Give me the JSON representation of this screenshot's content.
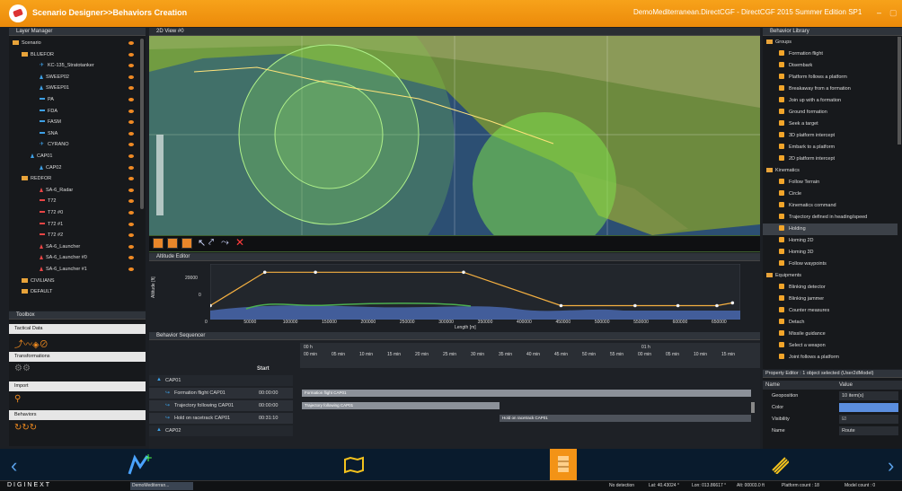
{
  "app": {
    "title": "Scenario Designer>>Behaviors Creation",
    "context": "DemoMediterranean.DirectCGF - DirectCGF 2015 Summer Edition SP1"
  },
  "layer_manager": {
    "title": "Layer Manager",
    "items": [
      {
        "label": "Scenario",
        "indent": 0,
        "icon": "folder"
      },
      {
        "label": "BLUEFOR",
        "indent": 1,
        "icon": "folder"
      },
      {
        "label": "KC-135_Stratotanker",
        "indent": 3,
        "icon": "plane"
      },
      {
        "label": "SWEEP02",
        "indent": 3,
        "icon": "up"
      },
      {
        "label": "SWEEP01",
        "indent": 3,
        "icon": "up"
      },
      {
        "label": "PA",
        "indent": 3,
        "icon": "dash"
      },
      {
        "label": "FDA",
        "indent": 3,
        "icon": "dash"
      },
      {
        "label": "FASM",
        "indent": 3,
        "icon": "dash"
      },
      {
        "label": "SNA",
        "indent": 3,
        "icon": "dash"
      },
      {
        "label": "CYRANO",
        "indent": 3,
        "icon": "plane"
      },
      {
        "label": "CAP01",
        "indent": 2,
        "icon": "up"
      },
      {
        "label": "CAP02",
        "indent": 3,
        "icon": "up"
      },
      {
        "label": "REDFOR",
        "indent": 1,
        "icon": "folder"
      },
      {
        "label": "SA-6_Radar",
        "indent": 3,
        "icon": "up-red"
      },
      {
        "label": "T72",
        "indent": 3,
        "icon": "dash-red"
      },
      {
        "label": "T72 #0",
        "indent": 3,
        "icon": "dash-red"
      },
      {
        "label": "T72 #1",
        "indent": 3,
        "icon": "dash-red"
      },
      {
        "label": "T72 #2",
        "indent": 3,
        "icon": "dash-red"
      },
      {
        "label": "SA-6_Launcher",
        "indent": 3,
        "icon": "up-red"
      },
      {
        "label": "SA-6_Launcher #0",
        "indent": 3,
        "icon": "up-red"
      },
      {
        "label": "SA-6_Launcher #1",
        "indent": 3,
        "icon": "up-red"
      },
      {
        "label": "CIVILIANS",
        "indent": 1,
        "icon": "folder"
      },
      {
        "label": "DEFAULT",
        "indent": 1,
        "icon": "folder"
      }
    ]
  },
  "toolbox": {
    "title": "Toolbox",
    "sections": [
      "Tactical Data",
      "Transformations",
      "Import",
      "Behaviors"
    ]
  },
  "view2d": {
    "title": "2D View #0"
  },
  "altitude": {
    "title": "Altitude Editor",
    "ylabel": "Altitude [ft]",
    "xlabel": "Length [m]",
    "yticks": [
      "20000",
      "0"
    ],
    "xticks": [
      "0",
      "50000",
      "100000",
      "150000",
      "200000",
      "250000",
      "300000",
      "350000",
      "400000",
      "450000",
      "500000",
      "550000",
      "600000",
      "650000"
    ]
  },
  "chart_data": {
    "type": "line",
    "title": "",
    "xlabel": "Length [m]",
    "ylabel": "Altitude [ft]",
    "xlim": [
      0,
      680000
    ],
    "ylim": [
      -8000,
      32000
    ],
    "series": [
      {
        "values": [
          [
            0,
            2000
          ],
          [
            70000,
            26000
          ],
          [
            135000,
            26000
          ],
          [
            325000,
            26000
          ],
          [
            450000,
            2000
          ],
          [
            545000,
            2000
          ],
          [
            600000,
            2000
          ],
          [
            650000,
            2000
          ],
          [
            670000,
            4000
          ]
        ]
      }
    ]
  },
  "sequencer": {
    "title": "Behavior Sequencer",
    "start_label": "Start",
    "time_head": [
      "00 h",
      "01 h"
    ],
    "time_ticks": [
      "00 min",
      "05 min",
      "10 min",
      "15 min",
      "20 min",
      "25 min",
      "30 min",
      "35 min",
      "40 min",
      "45 min",
      "50 min",
      "55 min",
      "00 min",
      "05 min",
      "10 min",
      "15 min"
    ],
    "rows": [
      {
        "label": "CAP01",
        "start": "",
        "bar": "",
        "level": 0
      },
      {
        "label": "Formation flight CAP01",
        "start": "00:00:00",
        "bar": "Formation flight CAP01",
        "level": 1
      },
      {
        "label": "Trajectory following CAP01",
        "start": "00:00:00",
        "bar": "Trajectory following CAP01",
        "level": 1
      },
      {
        "label": "Hold on racetrack CAP01",
        "start": "00:31:10",
        "bar": "Hold on racetrack CAP01",
        "level": 1
      },
      {
        "label": "CAP02",
        "start": "",
        "bar": "",
        "level": 0
      }
    ]
  },
  "behavior_library": {
    "title": "Behavior Library",
    "groups": [
      {
        "label": "Groups",
        "items": [
          "Formation flight",
          "Disembark",
          "Platform follows a platform",
          "Breakaway from a formation",
          "Join up with a formation",
          "Ground formation",
          "Seek a target",
          "3D platform intercept",
          "Embark to a platform",
          "2D platform intercept"
        ]
      },
      {
        "label": "Kinematics",
        "items": [
          "Follow Terrain",
          "Circle",
          "Kinematics command",
          "Trajectory defined in heading/speed",
          "Holding",
          "Homing 2D",
          "Homing 3D",
          "Follow waypoints"
        ]
      },
      {
        "label": "Equipments",
        "items": [
          "Blinking detector",
          "Blinking jammer",
          "Counter measures",
          "Detach",
          "Missile guidance",
          "Select a weapon",
          "Joint follows a platform"
        ]
      }
    ],
    "selected": "Holding"
  },
  "property_editor": {
    "title": "Property Editor : 1 object selected (User2dModel)",
    "col_name": "Name",
    "col_value": "Value",
    "rows": [
      {
        "name": "Geoposition",
        "value": "10 item(s)"
      },
      {
        "name": "Color",
        "value": ""
      },
      {
        "name": "Visibility",
        "value": "☑"
      },
      {
        "name": "Name",
        "value": "Route"
      }
    ]
  },
  "status": {
    "brand": "DIGINEXT",
    "detection": "No detection",
    "lat": "Lat: 40.43024 °",
    "lon": "Lon: 013.86617 °",
    "alt": "Alt: 00003.0 ft",
    "platforms": "Platform count : 18",
    "models": "Model count : 0",
    "task": "DemoMediterran..."
  },
  "colors": {
    "accent": "#f39316",
    "nav_bg": "#091b2d",
    "panel_bg": "#17191c"
  }
}
